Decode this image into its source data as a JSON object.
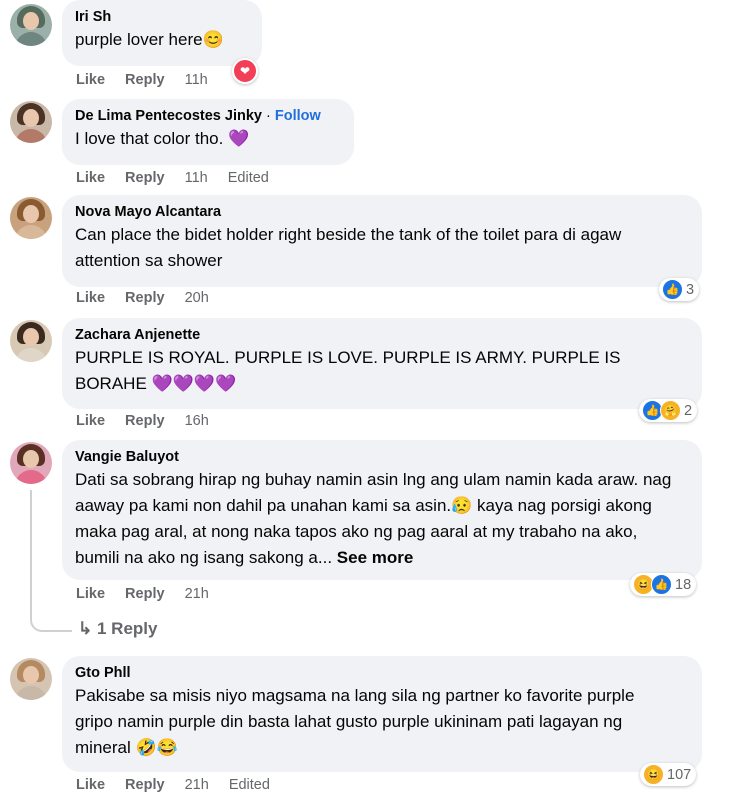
{
  "comments": [
    {
      "name": "Iri Sh",
      "text": "purple lover here",
      "emoji": "😊",
      "actions": [
        "Like",
        "Reply"
      ],
      "time": "11h"
    },
    {
      "name": "De Lima Pentecostes Jinky",
      "follow": "Follow",
      "separator": " · ",
      "text": "I love that color tho. ",
      "emoji": "💜",
      "actions": [
        "Like",
        "Reply"
      ],
      "time": "11h",
      "edited": "Edited"
    },
    {
      "name": "Nova Mayo Alcantara",
      "text": "Can place the bidet holder right beside the tank of the toilet para di agaw attention sa shower",
      "actions": [
        "Like",
        "Reply"
      ],
      "time": "20h",
      "reactions": "3"
    },
    {
      "name": "Zachara Anjenette",
      "text": "PURPLE IS ROYAL. PURPLE IS LOVE. PURPLE IS ARMY. PURPLE IS BORAHE ",
      "emoji": "💜💜💜💜",
      "actions": [
        "Like",
        "Reply"
      ],
      "time": "16h",
      "reactions": "2"
    },
    {
      "name": "Vangie Baluyot",
      "text": "Dati sa sobrang hirap ng buhay namin asin lng ang ulam namin kada araw. nag aaway pa kami non dahil pa unahan kami sa asin.",
      "emoji": "😥",
      "text2": " kaya nag porsigi akong maka pag aral, at nong naka tapos ako ng pag aaral at my trabaho na ako, bumili na ako ng isang sakong a... ",
      "see_more": "See more",
      "actions": [
        "Like",
        "Reply"
      ],
      "time": "21h",
      "reactions": "18",
      "reply_count": "1 Reply",
      "reply_icon": "↳"
    },
    {
      "name": "Gto Phll",
      "text": "Pakisabe sa misis niyo magsama na lang sila ng partner ko favorite purple gripo namin purple din basta lahat gusto purple ukininam pati lagayan ng mineral ",
      "emoji": "🤣😂",
      "actions": [
        "Like",
        "Reply"
      ],
      "time": "21h",
      "edited": "Edited",
      "reactions": "107"
    }
  ],
  "icons": {
    "like": "👍",
    "care": "🤗",
    "haha": "😆",
    "love": "❤"
  },
  "colors": {
    "bubble": "#f0f2f5",
    "link": "#216fdb",
    "meta": "#65676b"
  }
}
